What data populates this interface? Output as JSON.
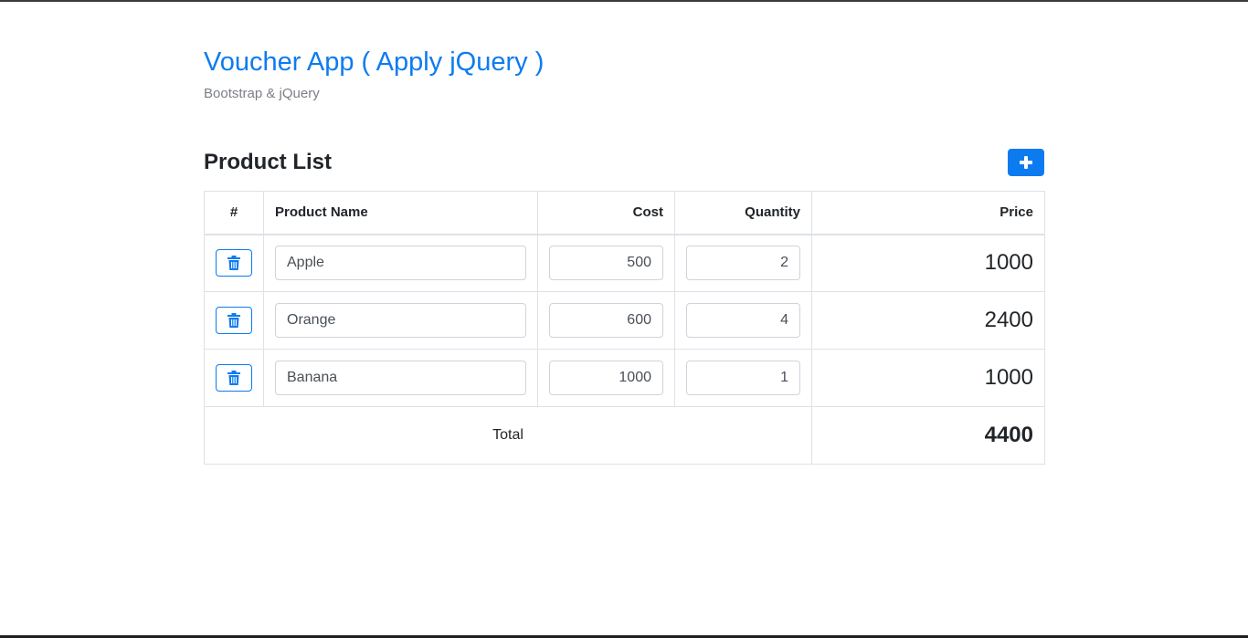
{
  "header": {
    "title": "Voucher App ( Apply jQuery )",
    "subtitle": "Bootstrap & jQuery"
  },
  "section": {
    "title": "Product List",
    "add_button_icon": "plus-icon"
  },
  "colors": {
    "primary": "#0d7bf0",
    "muted": "#7a7f85",
    "border": "#dee2e6"
  },
  "table": {
    "headers": [
      "#",
      "Product Name",
      "Cost",
      "Quantity",
      "Price"
    ],
    "rows": [
      {
        "delete_icon": "trash-icon",
        "name": "Apple",
        "cost": "500",
        "quantity": "2",
        "price": "1000"
      },
      {
        "delete_icon": "trash-icon",
        "name": "Orange",
        "cost": "600",
        "quantity": "4",
        "price": "2400"
      },
      {
        "delete_icon": "trash-icon",
        "name": "Banana",
        "cost": "1000",
        "quantity": "1",
        "price": "1000"
      }
    ],
    "total_label": "Total",
    "total_value": "4400"
  }
}
